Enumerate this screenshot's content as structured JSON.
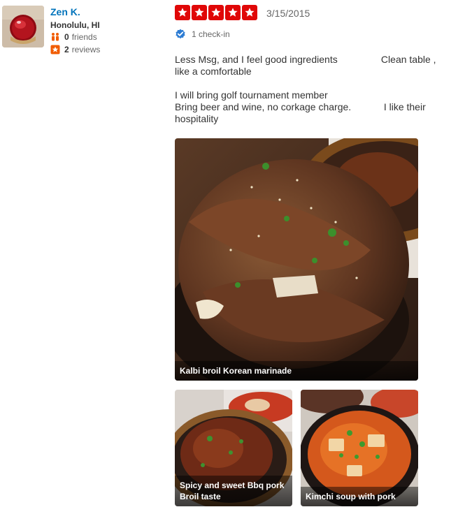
{
  "user": {
    "name": "Zen K.",
    "location": "Honolulu, HI",
    "friends_count": "0",
    "friends_label": "friends",
    "reviews_count": "2",
    "reviews_label": "reviews"
  },
  "review": {
    "rating": 5,
    "rating_max": 5,
    "date": "3/15/2015",
    "checkin_label": "1 check-in",
    "paragraph_1": "Less Msg, and I feel good ingredients                Clean table , like a comfortable",
    "paragraph_2": "I will bring golf tournament member\nBring beer and wine, no corkage charge.            I like their hospitality"
  },
  "photos": {
    "main_caption": "Kalbi broil Korean marinade",
    "second_caption": "Spicy and sweet Bbq pork Broil taste",
    "third_caption": "Kimchi soup with pork"
  },
  "colors": {
    "star_red": "#e00707",
    "link_blue": "#0073bb",
    "checkin_blue": "#2d7cd3",
    "review_badge": "#f15c00"
  },
  "icons": {
    "star": "star-icon",
    "friends": "friends-icon",
    "reviews": "review-star-icon",
    "checkin": "checkin-badge-icon"
  }
}
